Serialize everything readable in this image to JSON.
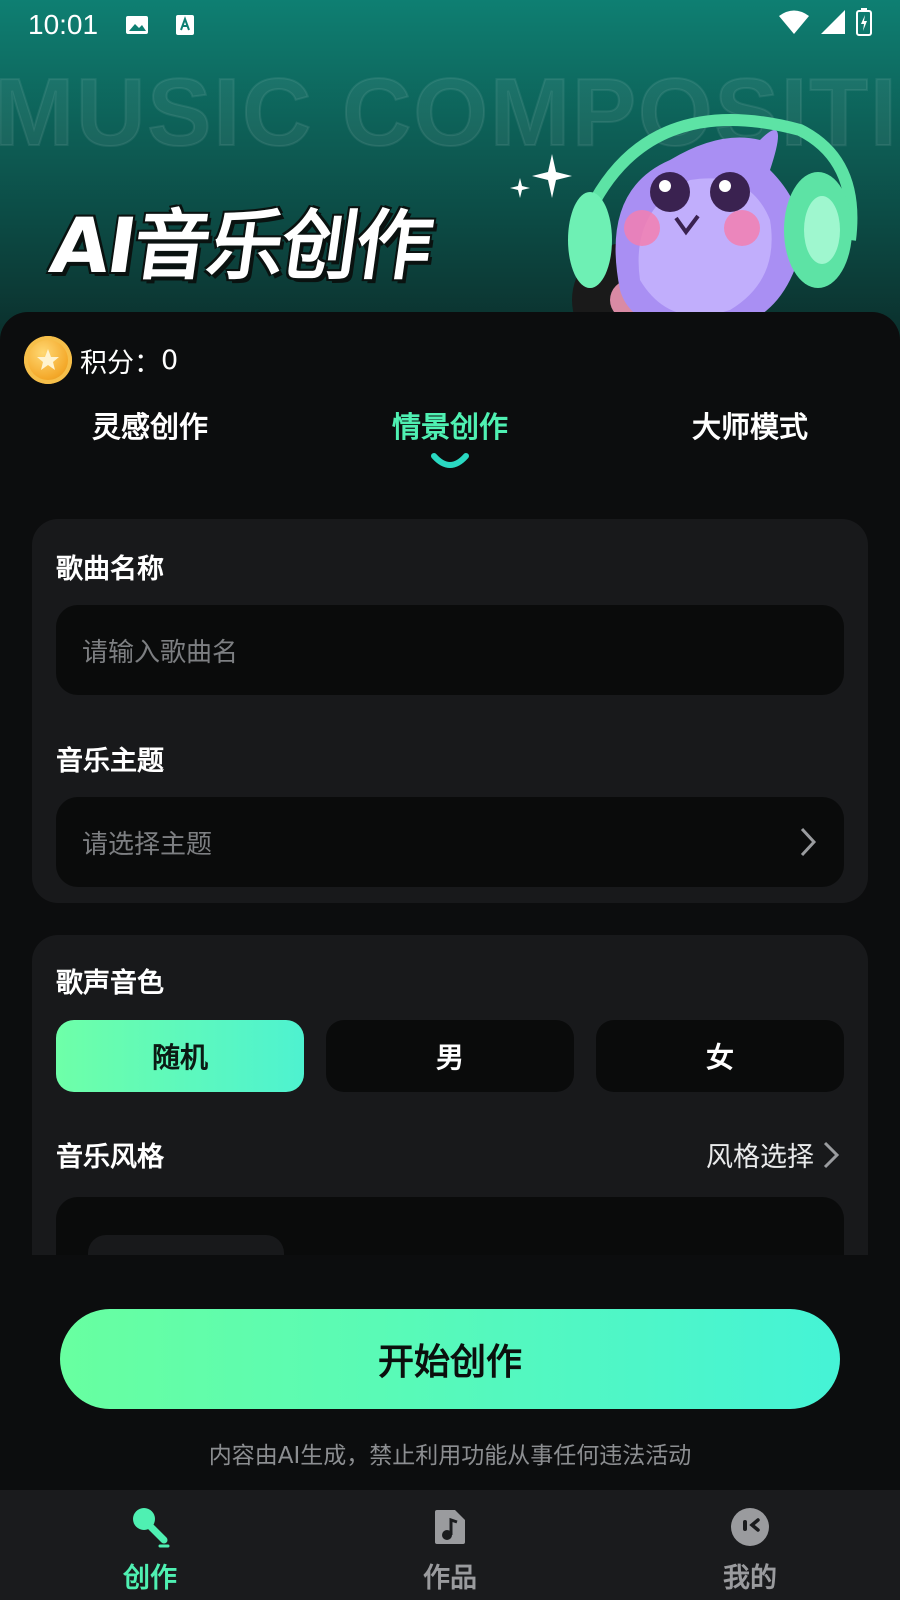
{
  "status_bar": {
    "time": "10:01"
  },
  "hero": {
    "background_word": "MUSIC COMPOSITION",
    "title": "AI音乐创作"
  },
  "points": {
    "label": "积分：",
    "value": "0"
  },
  "tabs": [
    {
      "label": "灵感创作",
      "active": false
    },
    {
      "label": "情景创作",
      "active": true
    },
    {
      "label": "大师模式",
      "active": false
    }
  ],
  "form": {
    "song_name": {
      "label": "歌曲名称",
      "placeholder": "请输入歌曲名",
      "value": ""
    },
    "theme": {
      "label": "音乐主题",
      "placeholder": "请选择主题"
    },
    "voice": {
      "label": "歌声音色",
      "options": [
        {
          "label": "随机",
          "selected": true
        },
        {
          "label": "男",
          "selected": false
        },
        {
          "label": "女",
          "selected": false
        }
      ]
    },
    "style": {
      "label": "音乐风格",
      "link": "风格选择"
    }
  },
  "start_button": "开始创作",
  "disclaimer": "内容由AI生成，禁止利用功能从事任何违法活动",
  "bottom_nav": [
    {
      "label": "创作",
      "icon": "microphone-icon",
      "active": true
    },
    {
      "label": "作品",
      "icon": "music-note-icon",
      "active": false
    },
    {
      "label": "我的",
      "icon": "profile-face-icon",
      "active": false
    }
  ],
  "colors": {
    "accent": "#4ff0b2",
    "gradient_start": "#68ffa0",
    "gradient_end": "#45f3d6",
    "card_bg": "#18191b",
    "page_bg": "#0c0d0e"
  }
}
